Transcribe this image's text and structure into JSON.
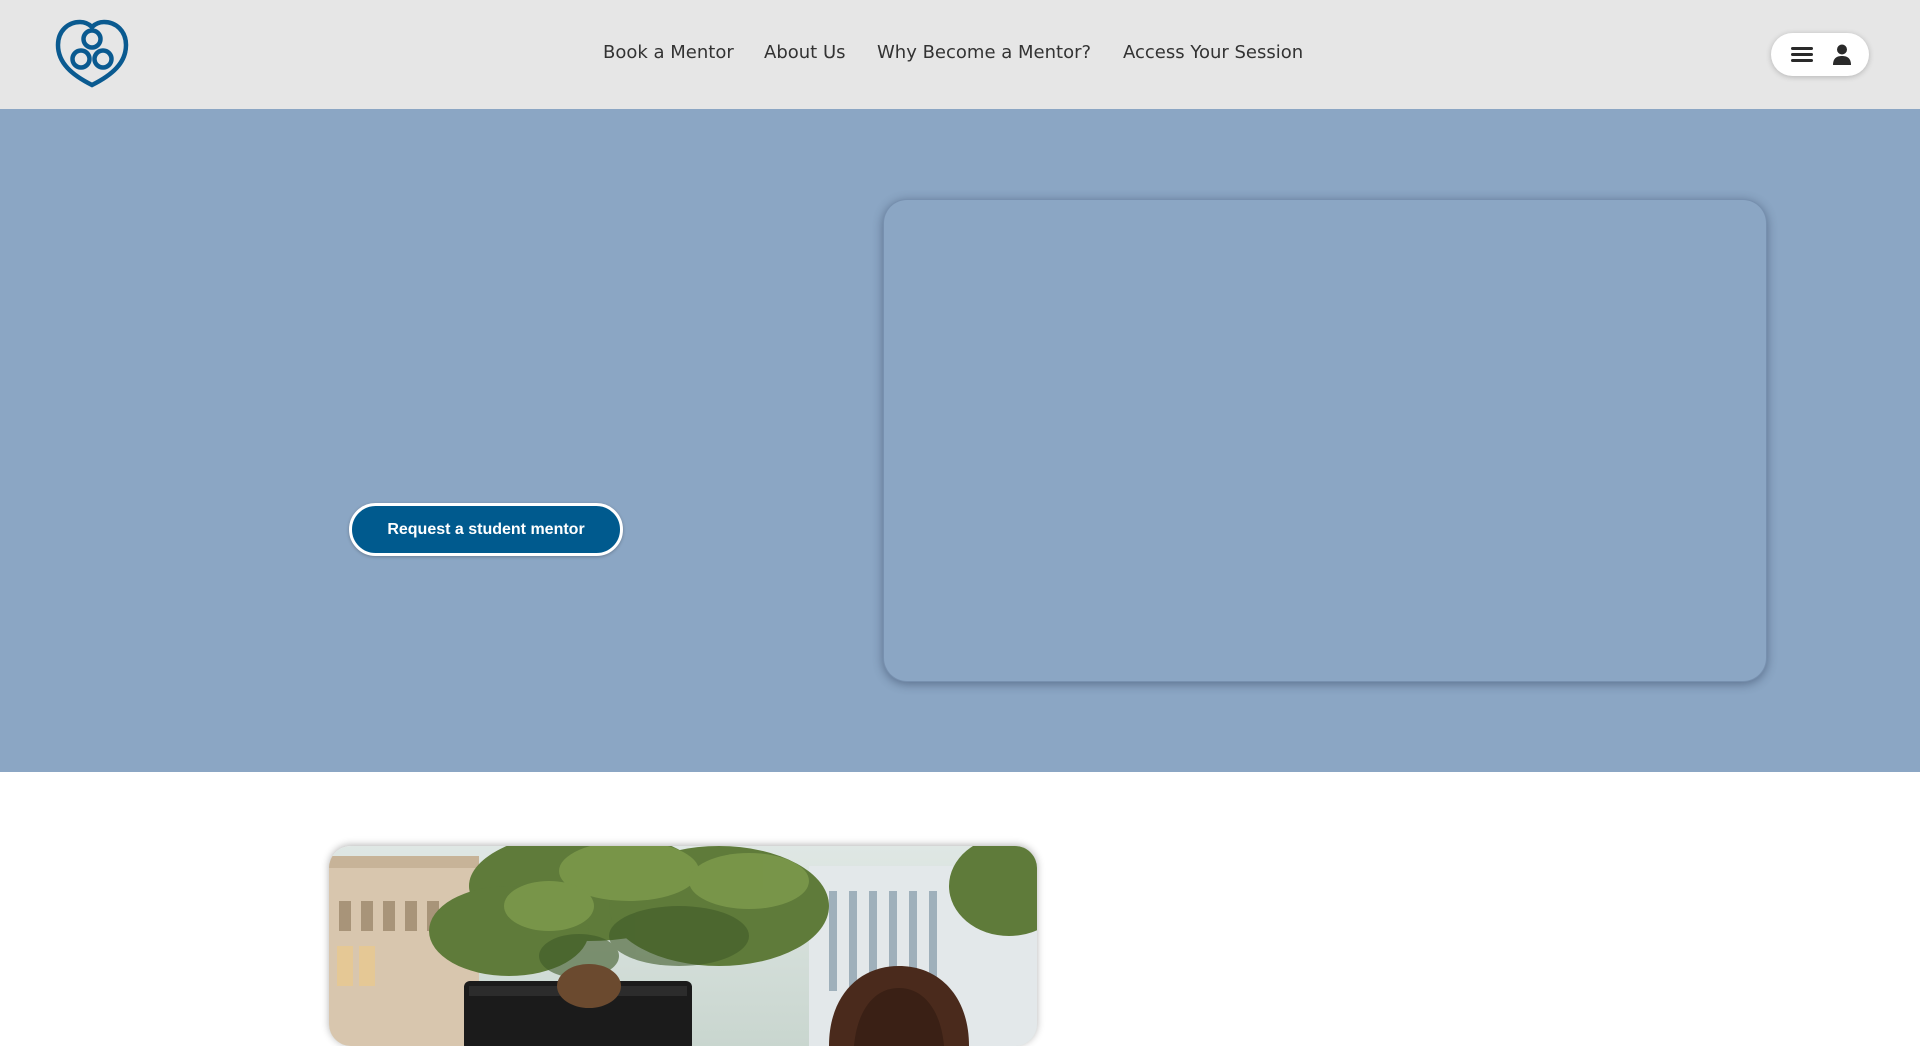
{
  "header": {
    "nav": [
      {
        "label": "Book a Mentor"
      },
      {
        "label": "About Us"
      },
      {
        "label": "Why Become a Mentor?"
      },
      {
        "label": "Access Your Session"
      }
    ],
    "icons": {
      "logo": "logo-icon",
      "menu": "menu-icon",
      "user": "user-icon"
    }
  },
  "hero": {
    "cta_label": "Request a student mentor"
  },
  "colors": {
    "header_bg": "#e6e6e6",
    "hero_bg": "#8ba6c4",
    "brand": "#005a8e"
  }
}
